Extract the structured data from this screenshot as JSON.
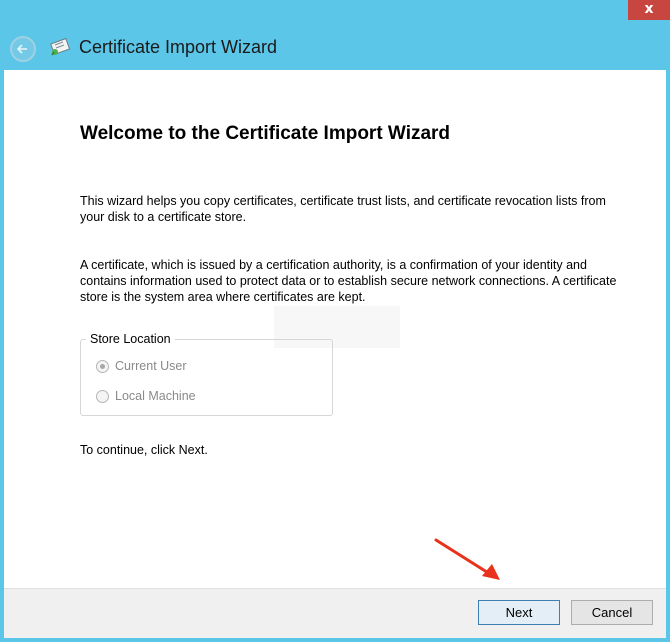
{
  "window": {
    "title": "Certificate Import Wizard",
    "close_label": "x"
  },
  "wizard": {
    "heading": "Welcome to the Certificate Import Wizard",
    "intro": "This wizard helps you copy certificates, certificate trust lists, and certificate revocation lists from your disk to a certificate store.",
    "description": "A certificate, which is issued by a certification authority, is a confirmation of your identity and contains information used to protect data or to establish secure network connections. A certificate store is the system area where certificates are kept.",
    "store_location": {
      "legend": "Store Location",
      "options": [
        {
          "label": "Current User",
          "selected": true,
          "enabled": false
        },
        {
          "label": "Local Machine",
          "selected": false,
          "enabled": false
        }
      ]
    },
    "continue_text": "To continue, click Next."
  },
  "footer": {
    "next_label": "Next",
    "cancel_label": "Cancel"
  },
  "colors": {
    "titlebar": "#5bc6e8",
    "close_button": "#c7463f",
    "annotation_arrow": "#e8321c"
  },
  "icons": {
    "back": "back-arrow-icon",
    "app": "certificate-icon",
    "annotation": "red-arrow-annotation"
  }
}
